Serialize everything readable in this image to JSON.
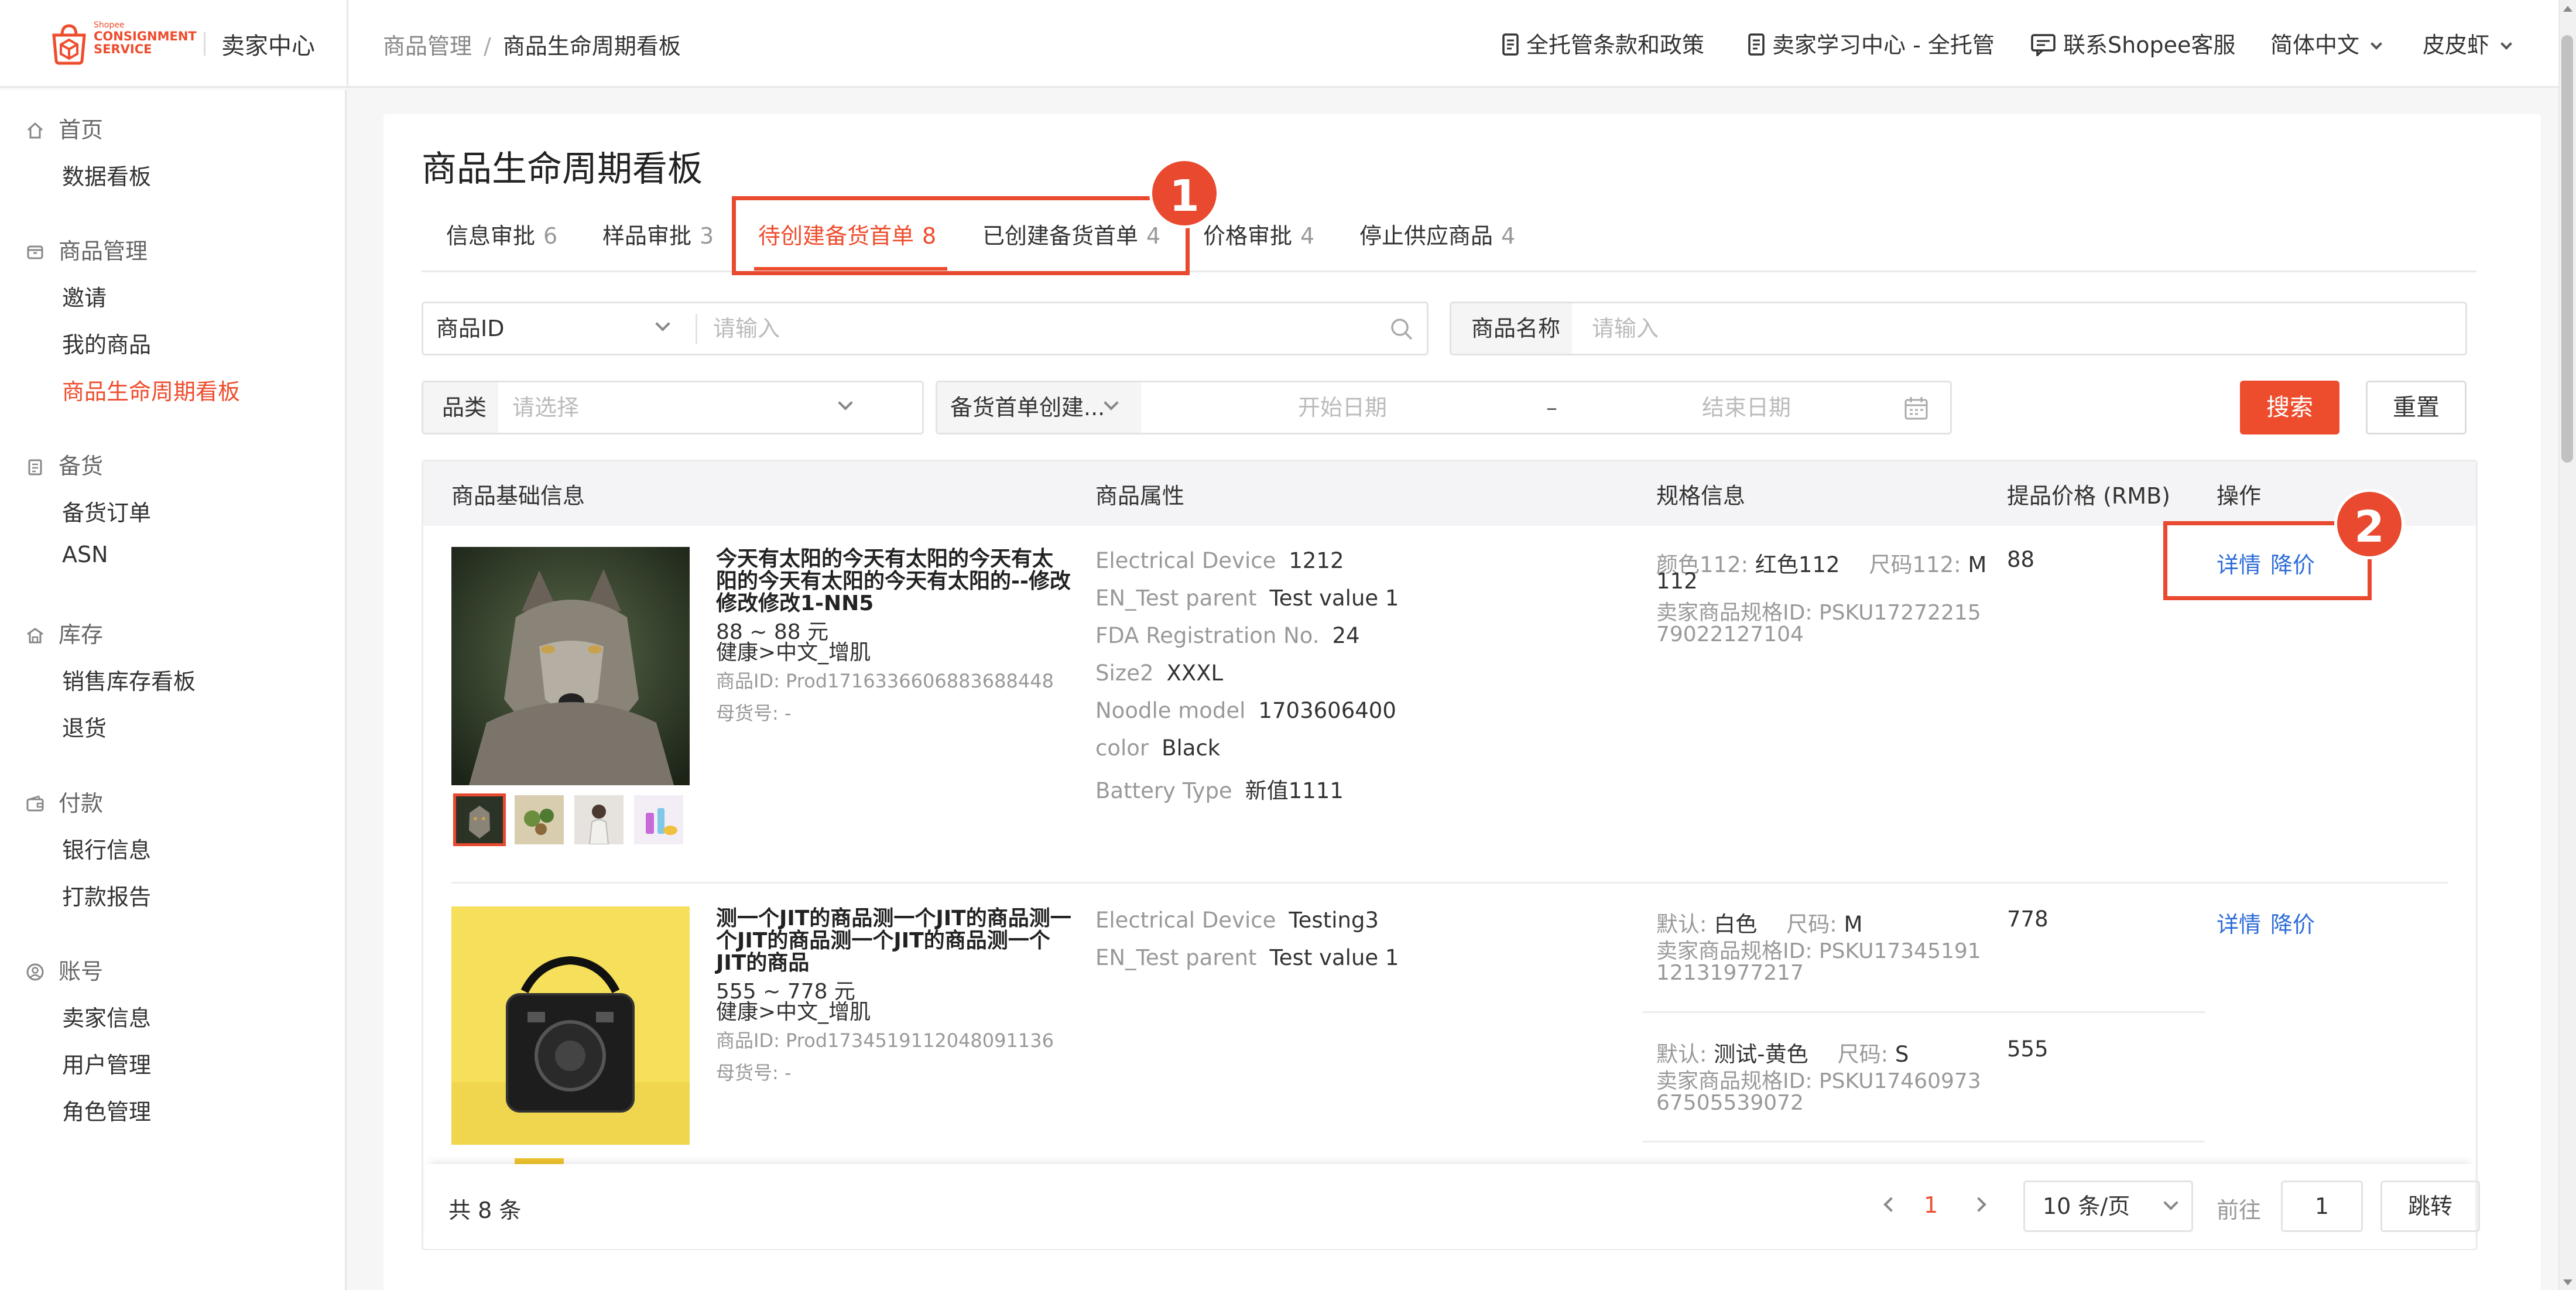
{
  "header": {
    "logo_small": "Shopee",
    "logo_line1": "CONSIGNMENT",
    "logo_line2": "SERVICE",
    "seller_center": "卖家中心",
    "breadcrumb": [
      "商品管理",
      "/",
      "商品生命周期看板"
    ],
    "links": [
      "全托管条款和政策",
      "卖家学习中心 - 全托管",
      "联系Shopee客服"
    ],
    "language": "简体中文",
    "user": "皮皮虾"
  },
  "sidebar": {
    "groups": [
      {
        "label": "首页",
        "icon": "home-icon",
        "items": [
          "数据看板"
        ]
      },
      {
        "label": "商品管理",
        "icon": "box-icon",
        "items": [
          "邀请",
          "我的商品",
          "商品生命周期看板"
        ]
      },
      {
        "label": "备货",
        "icon": "clipboard-icon",
        "items": [
          "备货订单",
          "ASN"
        ]
      },
      {
        "label": "库存",
        "icon": "warehouse-icon",
        "items": [
          "销售库存看板",
          "退货"
        ]
      },
      {
        "label": "付款",
        "icon": "wallet-icon",
        "items": [
          "银行信息",
          "打款报告"
        ]
      },
      {
        "label": "账号",
        "icon": "user-icon",
        "items": [
          "卖家信息",
          "用户管理",
          "角色管理"
        ]
      }
    ],
    "active_item": "商品生命周期看板"
  },
  "page": {
    "title": "商品生命周期看板",
    "tabs": [
      {
        "label": "信息审批",
        "count": "6"
      },
      {
        "label": "样品审批",
        "count": "3"
      },
      {
        "label": "待创建备货首单",
        "count": "8"
      },
      {
        "label": "已创建备货首单",
        "count": "4"
      },
      {
        "label": "价格审批",
        "count": "4"
      },
      {
        "label": "停止供应商品",
        "count": "4"
      }
    ],
    "active_tab": "待创建备货首单"
  },
  "filters": {
    "id_select": "商品ID",
    "id_placeholder": "请输入",
    "name_label": "商品名称",
    "name_placeholder": "请输入",
    "category_label": "品类",
    "category_placeholder": "请选择",
    "date_select": "备货首单创建...",
    "start_placeholder": "开始日期",
    "range_sep": "–",
    "end_placeholder": "结束日期",
    "search": "搜索",
    "reset": "重置"
  },
  "table": {
    "columns": [
      "商品基础信息",
      "商品属性",
      "规格信息",
      "提品价格 (RMB)",
      "操作"
    ],
    "rows": [
      {
        "name": "今天有太阳的今天有太阳的今天有太阳的今天有太阳的今天有太阳的--修改修改修改1-NN5",
        "price_range": "88 ~ 88 元",
        "category": "健康>中文_增肌",
        "product_id": "商品ID: Prod1716336606883688448",
        "parent_sku": "母货号: -",
        "attributes": [
          {
            "k": "Electrical Device",
            "v": "1212"
          },
          {
            "k": "EN_Test parent",
            "v": "Test value 1"
          },
          {
            "k": "FDA Registration No.",
            "v": "24"
          },
          {
            "k": "Size2",
            "v": "XXXL"
          },
          {
            "k": "Noodle model",
            "v": "1703606400"
          },
          {
            "k": "color",
            "v": "Black"
          },
          {
            "k": "Battery Type",
            "v": "新值1111"
          }
        ],
        "specs": [
          {
            "k1": "颜色112:",
            "v1": "红色112",
            "k2": "尺码112:",
            "v2": "M",
            "cont": "112",
            "sku": "卖家商品规格ID: PSKU1727221579022127104",
            "price": "88"
          }
        ],
        "ops": [
          "详情",
          "降价"
        ]
      },
      {
        "name": "测一个JIT的商品测一个JIT的商品测一个JIT的商品测一个JIT的商品测一个JIT的商品",
        "price_range": "555 ~ 778 元",
        "category": "健康>中文_增肌",
        "product_id": "商品ID: Prod1734519112048091136",
        "parent_sku": "母货号: -",
        "attributes": [
          {
            "k": "Electrical Device",
            "v": "Testing3"
          },
          {
            "k": "EN_Test parent",
            "v": "Test value 1"
          }
        ],
        "specs": [
          {
            "k1": "默认:",
            "v1": "白色",
            "k2": "尺码:",
            "v2": "M",
            "cont": "",
            "sku": "卖家商品规格ID: PSKU1734519112131977217",
            "price": "778"
          },
          {
            "k1": "默认:",
            "v1": "测试-黄色",
            "k2": "尺码:",
            "v2": "S",
            "cont": "",
            "sku": "卖家商品规格ID: PSKU1746097367505539072",
            "price": "555"
          }
        ],
        "ops": [
          "详情",
          "降价"
        ]
      }
    ]
  },
  "pagination": {
    "total": "共 8 条",
    "current": "1",
    "page_size": "10 条/页",
    "goto_label": "前往",
    "goto_value": "1",
    "goto_button": "跳转"
  },
  "annotations": [
    "1",
    "2"
  ],
  "colors": {
    "accent": "#ee4d2d",
    "link": "#2e6dd8",
    "annotation": "#e8492f"
  }
}
